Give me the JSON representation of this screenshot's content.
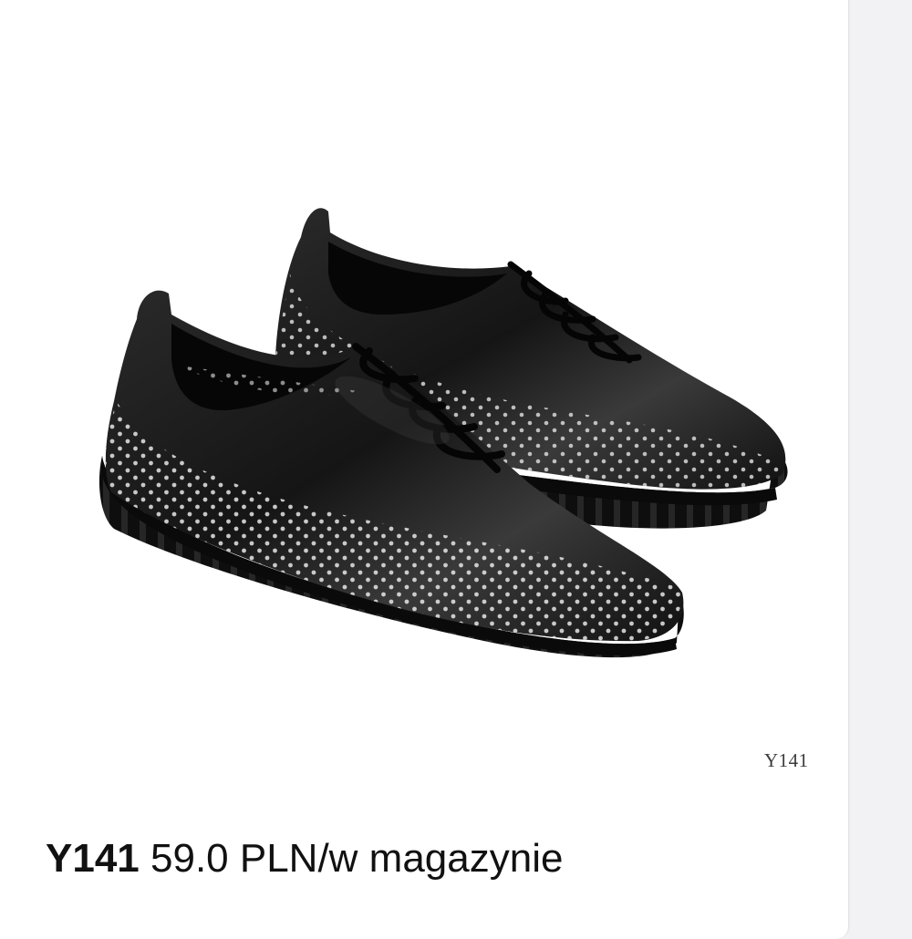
{
  "product": {
    "image_watermark": "Y141",
    "code": "Y141",
    "price_status": "59.0 PLN/w magazynie",
    "image_subject": "shoe-pair-icon"
  },
  "colors": {
    "shoe": "#141414",
    "sole": "#0c0c0c",
    "background": "#ffffff"
  }
}
